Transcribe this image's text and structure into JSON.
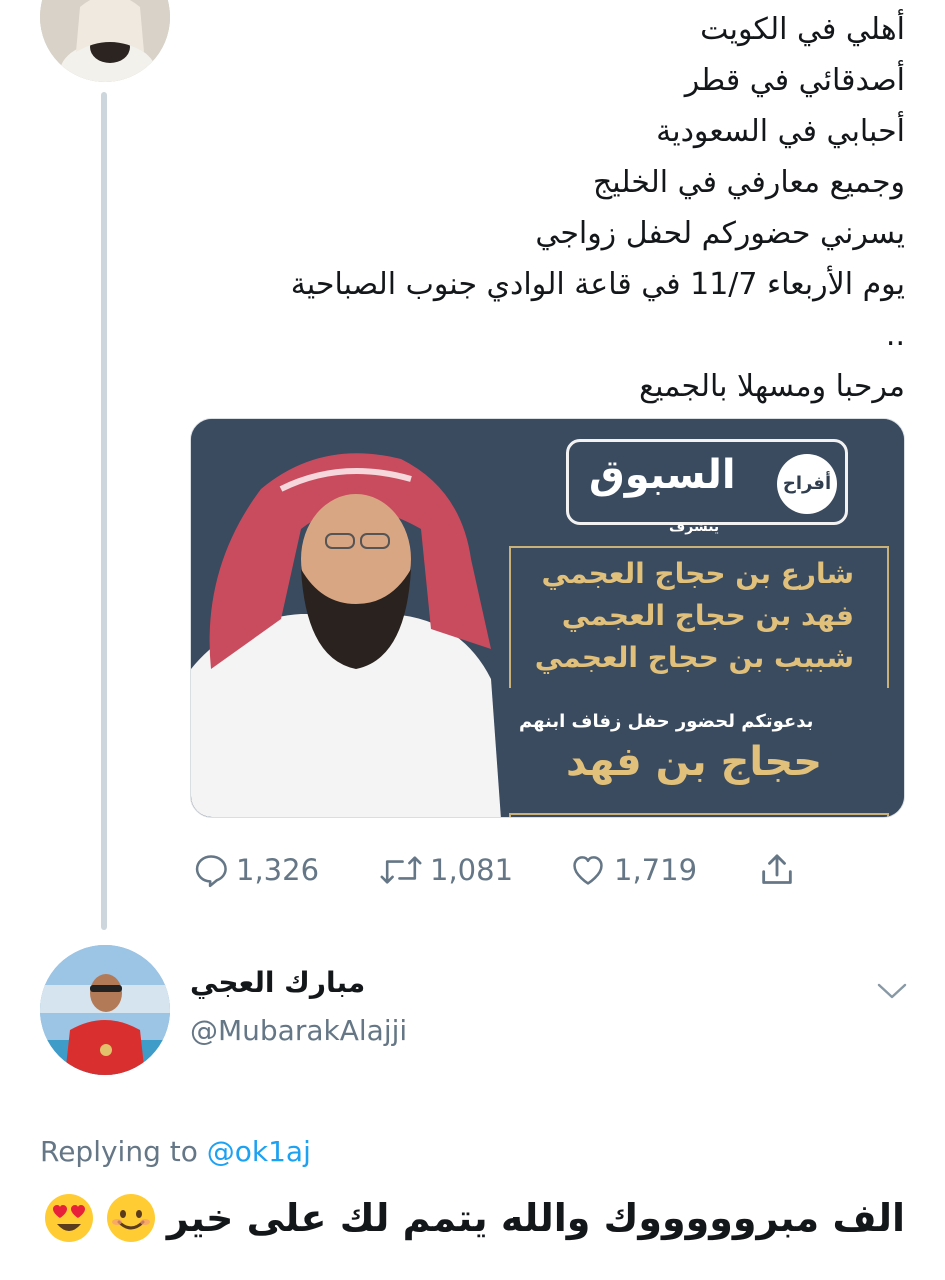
{
  "tweet": {
    "lines": [
      "أهلي في الكويت",
      "أصدقائي في قطر",
      "أحبابي في السعودية",
      "وجميع معارفي في الخليج",
      "يسرني حضوركم لحفل زواجي",
      "يوم الأربعاء 11/7 في قاعة الوادي جنوب الصباحية",
      "..",
      "مرحبا ومسهلا بالجميع"
    ],
    "media": {
      "logo_prefix": "أفراح",
      "logo_main": "السبوق",
      "honors": "يتشرف",
      "names": [
        "شارع بن حجاج العجمي",
        "فهد بن حجاج العجمي",
        "شبيب بن حجاج العجمي"
      ],
      "invite": "بدعوتكم لحضور حفل زفاف ابنهم",
      "groom": "حجاج بن فهد"
    },
    "actions": {
      "replies": "1,326",
      "retweets": "1,081",
      "likes": "1,719"
    }
  },
  "reply": {
    "name": "مبارك العجي",
    "handle": "@MubarakAlajji",
    "replying_prefix": "Replying to",
    "replying_to": "@ok1aj",
    "body": "الف مبروووووك والله يتمم لك على خير",
    "emojis": [
      "smiling-face-icon",
      "heart-eyes-icon"
    ]
  },
  "colors": {
    "link": "#1da1f2",
    "muted": "#657786",
    "thread_line": "#cdd6dd",
    "media_bg": "#3a4a5f",
    "gold": "#e0c07a"
  }
}
